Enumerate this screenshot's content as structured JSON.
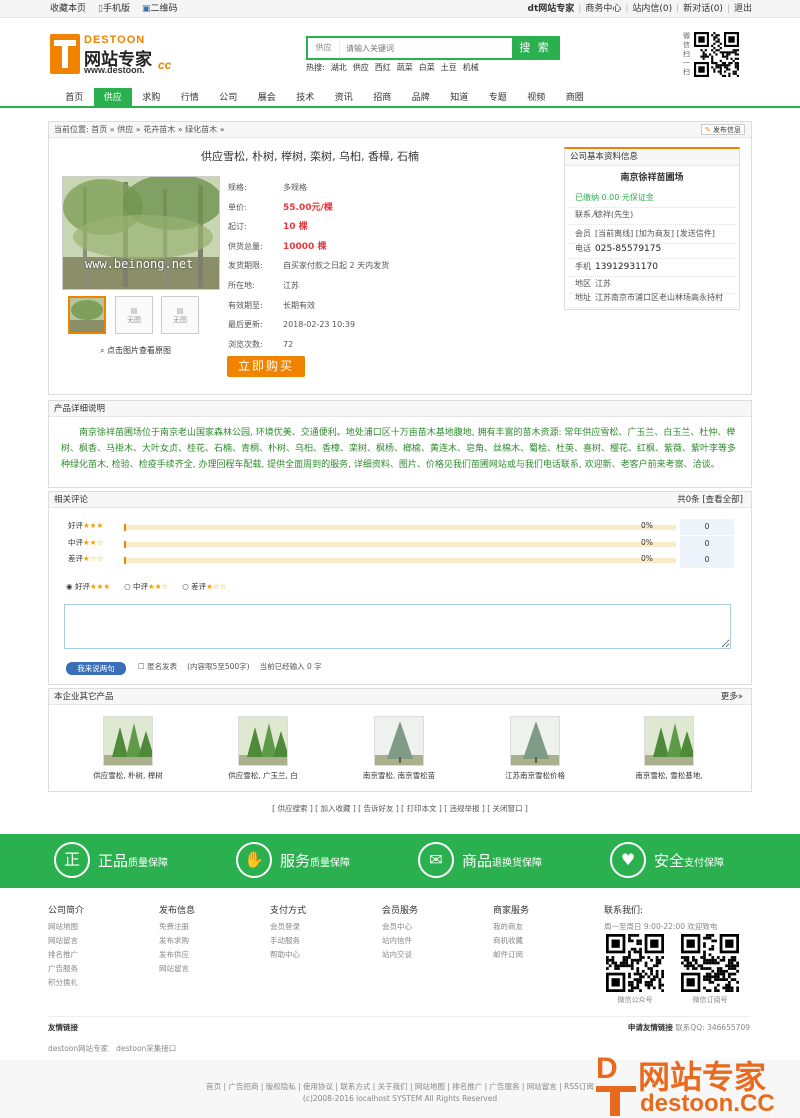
{
  "topbar": {
    "left": [
      "收藏本页",
      "手机版",
      "二维码"
    ],
    "right": [
      "dt网站专家",
      "商务中心",
      "站内信(0)",
      "新对话(0)",
      "退出"
    ]
  },
  "logo": {
    "brand": "DESTOON",
    "cn": "网站专家",
    "url": "www.destoon.",
    "cc": "cc"
  },
  "search": {
    "category": "供应",
    "placeholder": "请输入关键词",
    "button": "搜 索",
    "hot_label": "热搜:",
    "hot": [
      "湖北",
      "供应",
      "西红",
      "蔬菜",
      "白菜",
      "土豆",
      "机械"
    ]
  },
  "qr_top_label": "微信扫一扫",
  "nav": {
    "items": [
      "首页",
      "供应",
      "求购",
      "行情",
      "公司",
      "展会",
      "技术",
      "资讯",
      "招商",
      "品牌",
      "知道",
      "专题",
      "视频",
      "商圈"
    ],
    "active": "供应"
  },
  "breadcrumb": {
    "text": "当前位置: 首页 » 供应 » 花卉苗木 » 绿化苗木 »",
    "publish": "发布信息"
  },
  "product": {
    "title": "供应雪松, 朴树, 榉树, 栾树, 乌桕, 香樟, 石楠",
    "watermark": "www.beinong.net",
    "thumb_none": "无图",
    "view_big": "点击图片查看原图",
    "specs": [
      {
        "k": "规格:",
        "v": "多规格",
        "style": ""
      },
      {
        "k": "单价:",
        "v": "55.00元/棵",
        "style": "red"
      },
      {
        "k": "起订:",
        "v": "10 棵",
        "style": "red"
      },
      {
        "k": "供货总量:",
        "v": "10000 棵",
        "style": "red"
      },
      {
        "k": "发货期限:",
        "v": "自买家付款之日起 2 天内发货",
        "style": ""
      },
      {
        "k": "所在地:",
        "v": "江苏",
        "style": ""
      },
      {
        "k": "有效期至:",
        "v": "长期有效",
        "style": ""
      },
      {
        "k": "最后更新:",
        "v": "2018-02-23 10:39",
        "style": ""
      },
      {
        "k": "浏览次数:",
        "v": "72",
        "style": ""
      }
    ],
    "buy": "立即购买"
  },
  "company": {
    "header": "公司基本资料信息",
    "name": "南京徐祥苗圃场",
    "rows": [
      {
        "k": "",
        "v": "已缴纳 0.00 元保证金",
        "style": "green"
      },
      {
        "k": "联系人",
        "v": "徐祥(先生)",
        "style": ""
      },
      {
        "k": "会员",
        "v": "[当前离线] [加为商友] [发送信件]",
        "style": ""
      },
      {
        "k": "电话",
        "v": "025-85579175",
        "style": "big"
      },
      {
        "k": "手机",
        "v": "13912931170",
        "style": "big"
      },
      {
        "k": "地区",
        "v": "江苏",
        "style": ""
      },
      {
        "k": "地址",
        "v": "江苏南京市浦口区老山林场高永持村",
        "style": ""
      }
    ]
  },
  "detail": {
    "header": "产品详细说明",
    "text": "南京徐祥苗圃场位于南京老山国家森林公园, 环境优美、交通便利。地处浦口区十万亩苗木基地腹地, 拥有丰富的苗木资源: 常年供应雪松、广玉兰、白玉兰、杜仲、榉树、枫香、马褂木、大叶女贞、桂花、石楠、青桐、朴树、乌桕、香樟、栾树、枫杨、榔榆、黄连木、皂角、丝棉木、蜀桧、杜英、喜树、樱花、红枫、紫薇、紫叶李等多种绿化苗木, 检验、检疫手续齐全, 办理回程车配载, 提供全面周到的服务, 详细资料、图片、价格见我们苗圃网站或与我们电话联系, 欢迎新、老客户前来考察、洽谈。"
  },
  "comments": {
    "header": "相关评论",
    "summary": "共0条 [查看全部]",
    "rows": [
      {
        "label": "好评",
        "stars": "★★★",
        "pct": "0%",
        "count": "0"
      },
      {
        "label": "中评",
        "stars": "★★☆",
        "pct": "0%",
        "count": "0"
      },
      {
        "label": "差评",
        "stars": "★☆☆",
        "pct": "0%",
        "count": "0"
      }
    ],
    "select": [
      {
        "label": "好评",
        "stars": "★★★"
      },
      {
        "label": "中评",
        "stars": "★★☆"
      },
      {
        "label": "差评",
        "stars": "★☆☆"
      }
    ],
    "submit": "我来说两句",
    "anon": "匿名发表",
    "limit": "(内容限5至500字)",
    "typed": "当前已经输入 0 字"
  },
  "others": {
    "header": "本企业其它产品",
    "more": "更多»",
    "items": [
      "供应雪松, 朴树, 榉树",
      "供应雪松, 广玉兰, 白",
      "南京雪松, 南京雪松苗",
      "江苏南京雪松价格",
      "南京雪松, 雪松基地,"
    ]
  },
  "bottomlinks": "[ 供应搜索 ]  [ 加入收藏 ]  [ 告诉好友 ]  [ 打印本文 ]  [ 违规举报 ]  [ 关闭窗口 ]",
  "features": [
    {
      "icon": "正",
      "big": "正品",
      "small": "质量保障"
    },
    {
      "icon": "✋",
      "big": "服务",
      "small": "质量保障"
    },
    {
      "icon": "✉",
      "big": "商品",
      "small": "退换货保障"
    },
    {
      "icon": "♥",
      "big": "安全",
      "small": "支付保障"
    }
  ],
  "footer": {
    "cols": [
      {
        "h": "公司简介",
        "items": [
          "网站地图",
          "网站留言",
          "排名推广",
          "广告服务",
          "积分换礼"
        ]
      },
      {
        "h": "发布信息",
        "items": [
          "免费注册",
          "发布求购",
          "发布供应",
          "网站留言"
        ]
      },
      {
        "h": "支付方式",
        "items": [
          "会员登录",
          "手动服务",
          "帮助中心"
        ]
      },
      {
        "h": "会员服务",
        "items": [
          "会员中心",
          "站内信件",
          "站内交谈"
        ]
      },
      {
        "h": "商家服务",
        "items": [
          "我的商友",
          "商机收藏",
          "邮件订阅"
        ]
      }
    ],
    "contact_h": "联系我们:",
    "hours": "周一至周日 9:00-22:00 欢迎致电",
    "qr1": "微信公众号",
    "qr2": "微信订阅号",
    "friend": "友情链接",
    "apply": "申请友情链接",
    "qq_label": "联系QQ:",
    "qq": "346655709",
    "links": [
      "destoon网站专家",
      "destoon采集接口"
    ],
    "nav": "首页 | 广告招商 | 版权隐私 | 使用协议 | 联系方式 | 关于我们 | 网站地图 | 排名推广 | 广告服务 | 网站留言 | RSS订阅",
    "copy": "(c)2008-2016 localhost SYSTEM All Rights Reserved"
  },
  "watermark": {
    "d": "D",
    "cn": "网站专家",
    "en": "destoon.CC"
  },
  "colors": {
    "green": "#2bb04f",
    "orange": "#f08300",
    "red": "#e4393c"
  }
}
